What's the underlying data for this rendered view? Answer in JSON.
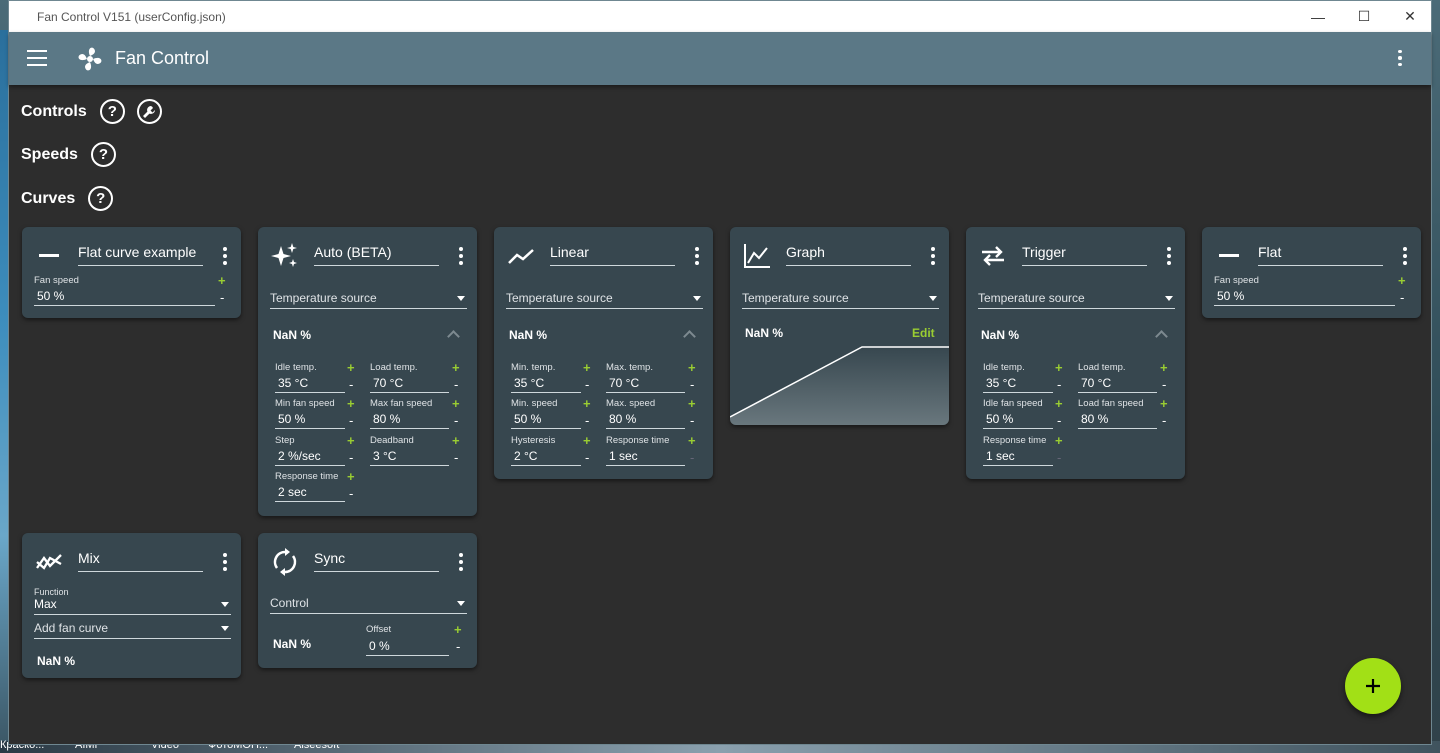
{
  "window": {
    "title": "Fan Control V151 (userConfig.json)",
    "min": "—",
    "max": "☐",
    "close": "✕"
  },
  "app": {
    "title": "Fan Control"
  },
  "sections": {
    "controls": "Controls",
    "speeds": "Speeds",
    "curves": "Curves",
    "help": "?"
  },
  "taskbar": [
    "Краско...",
    "AIMP",
    "Video",
    "ФотоМОН...",
    "Aiseesoft"
  ],
  "cards": {
    "flat_example": {
      "title": "Flat curve example",
      "fan_speed_label": "Fan speed",
      "fan_speed": "50 %"
    },
    "auto": {
      "title": "Auto (BETA)",
      "source": "Temperature source",
      "nan": "NaN %",
      "idle_temp_label": "Idle temp.",
      "idle_temp": "35 °C",
      "load_temp_label": "Load temp.",
      "load_temp": "70 °C",
      "min_fan_label": "Min fan speed",
      "min_fan": "50 %",
      "max_fan_label": "Max fan speed",
      "max_fan": "80 %",
      "step_label": "Step",
      "step": "2 %/sec",
      "deadband_label": "Deadband",
      "deadband": "3 °C",
      "resp_label": "Response time",
      "resp": "2 sec"
    },
    "linear": {
      "title": "Linear",
      "source": "Temperature source",
      "nan": "NaN %",
      "min_temp_label": "Min. temp.",
      "min_temp": "35 °C",
      "max_temp_label": "Max. temp.",
      "max_temp": "70 °C",
      "min_speed_label": "Min. speed",
      "min_speed": "50 %",
      "max_speed_label": "Max. speed",
      "max_speed": "80 %",
      "hyst_label": "Hysteresis",
      "hyst": "2 °C",
      "resp_label": "Response time",
      "resp": "1 sec"
    },
    "graph": {
      "title": "Graph",
      "source": "Temperature source",
      "nan": "NaN %",
      "edit": "Edit"
    },
    "trigger": {
      "title": "Trigger",
      "source": "Temperature source",
      "nan": "NaN %",
      "idle_temp_label": "Idle temp.",
      "idle_temp": "35 °C",
      "load_temp_label": "Load temp.",
      "load_temp": "70 °C",
      "idle_fan_label": "Idle fan speed",
      "idle_fan": "50 %",
      "load_fan_label": "Load fan speed",
      "load_fan": "80 %",
      "resp_label": "Response time",
      "resp": "1 sec"
    },
    "flat": {
      "title": "Flat",
      "fan_speed_label": "Fan speed",
      "fan_speed": "50 %"
    },
    "mix": {
      "title": "Mix",
      "function_label": "Function",
      "function": "Max",
      "add": "Add fan curve",
      "nan": "NaN %"
    },
    "sync": {
      "title": "Sync",
      "control": "Control",
      "nan": "NaN %",
      "offset_label": "Offset",
      "offset": "0 %"
    }
  },
  "symbols": {
    "plus": "+",
    "minus": "-"
  },
  "colors": {
    "accent": "#a2e016",
    "appbar": "#5b7886",
    "card": "#37474f",
    "background": "#2d2d2d"
  }
}
